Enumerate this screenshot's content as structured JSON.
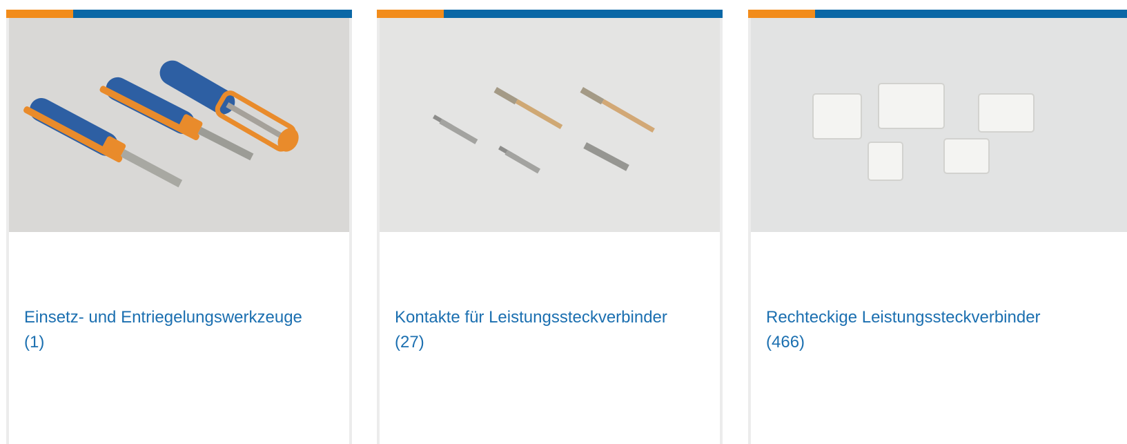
{
  "colors": {
    "accent_orange": "#f28c1b",
    "accent_blue": "#0a67a6",
    "link": "#1b6fb0"
  },
  "categories": [
    {
      "name": "Einsetz- und Entriegelungswerkzeuge",
      "count": "(1)",
      "image": "insertion-extraction-tools"
    },
    {
      "name": "Kontakte für Leistungssteckverbinder",
      "count": "(27)",
      "image": "power-connector-contacts"
    },
    {
      "name": "Rechteckige Leistungssteckverbinder",
      "count": "(466)",
      "image": "rectangular-power-connectors"
    }
  ]
}
